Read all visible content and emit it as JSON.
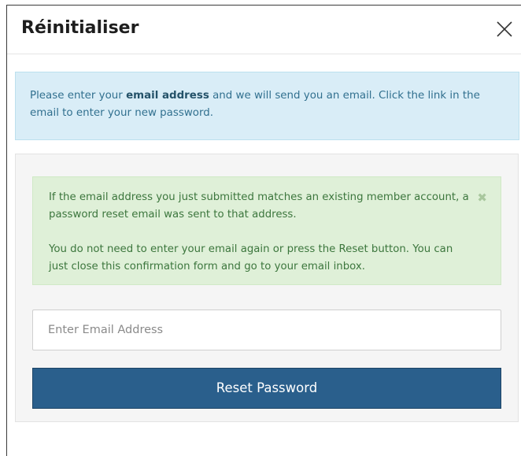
{
  "dialog": {
    "title": "Réinitialiser",
    "close_icon": "close-icon"
  },
  "info_alert": {
    "text_before": "Please enter your ",
    "bold_text": "email address",
    "text_after": " and we will send you an email. Click the link in the email to enter your new password."
  },
  "success_alert": {
    "paragraph_1": "If the email address you just submitted matches an existing member account, a password reset email was sent to that address.",
    "paragraph_2": "You do not need to enter your email again or press the Reset button. You can just close this confirmation form and go to your email inbox.",
    "dismiss_glyph": "✖"
  },
  "form": {
    "email_placeholder": "Enter Email Address",
    "email_value": "",
    "reset_label": "Reset Password"
  },
  "colors": {
    "info_bg": "#d9edf7",
    "success_bg": "#dff0d8",
    "button_bg": "#2a5f8c"
  }
}
